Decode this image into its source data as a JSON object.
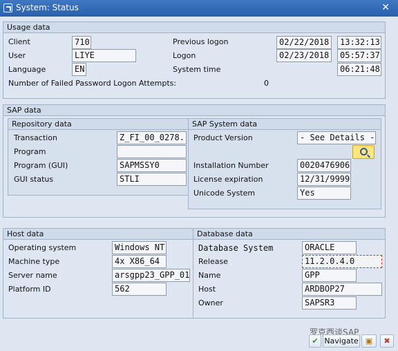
{
  "window": {
    "title": "System: Status",
    "close_glyph": "✕"
  },
  "usage": {
    "title": "Usage data",
    "client_label": "Client",
    "client": "710",
    "user_label": "User",
    "user": "LIYE",
    "language_label": "Language",
    "language": "EN",
    "prev_logon_label": "Previous logon",
    "prev_logon_date": "02/22/2018",
    "prev_logon_time": "13:32:13",
    "logon_label": "Logon",
    "logon_date": "02/23/2018",
    "logon_time": "05:57:37",
    "system_time_label": "System time",
    "system_time": "06:21:48",
    "failed_label": "Number of Failed Password Logon Attempts:",
    "failed": "0"
  },
  "sap": {
    "title": "SAP data",
    "repo_title": "Repository data",
    "transaction_label": "Transaction",
    "transaction": "Z_FI_00_0278...",
    "program_label": "Program",
    "program": "",
    "program_gui_label": "Program (GUI)",
    "program_gui": "SAPMSSY0",
    "gui_status_label": "GUI status",
    "gui_status": "STLI",
    "sys_title": "SAP System data",
    "product_version_label": "Product Version",
    "product_version": "- See Details -",
    "install_label": "Installation Number",
    "install": "0020476906",
    "license_label": "License expiration",
    "license": "12/31/9999",
    "unicode_label": "Unicode System",
    "unicode": "Yes"
  },
  "host": {
    "title": "Host data",
    "os_label": "Operating system",
    "os": "Windows NT",
    "machine_label": "Machine type",
    "machine": "4x X86_64",
    "server_label": "Server name",
    "server": "arsgpp23_GPP_01",
    "platform_label": "Platform ID",
    "platform": "562"
  },
  "db": {
    "title": "Database data",
    "system_label": "Database System",
    "system": "ORACLE",
    "release_label": "Release",
    "release": "11.2.0.4.0",
    "name_label": "Name",
    "name": "GPP",
    "host_label": "Host",
    "host": "ARDBOP27",
    "owner_label": "Owner",
    "owner": "SAPSR3"
  },
  "footer": {
    "navigate": "Navigate",
    "watermark": "罗克西谈SAP"
  }
}
